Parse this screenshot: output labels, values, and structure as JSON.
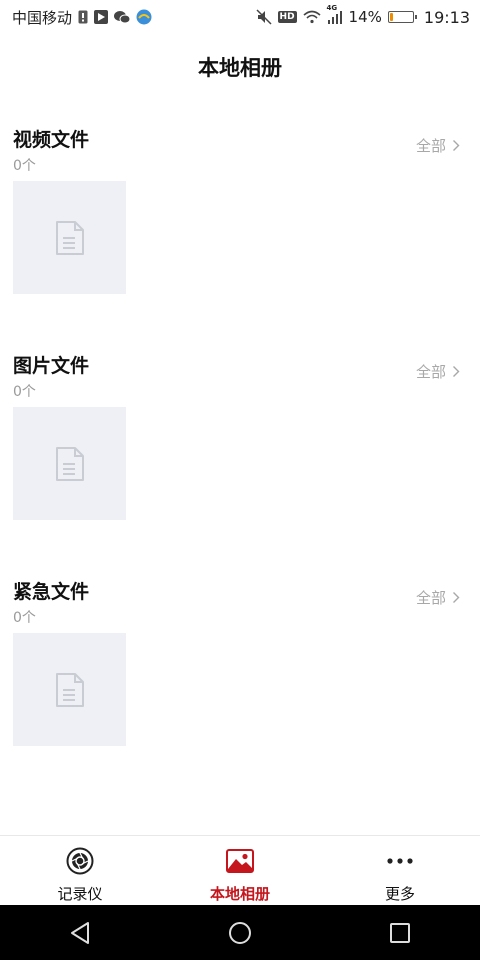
{
  "status_bar": {
    "carrier": "中国移动",
    "network_badge": "HD",
    "signal_type": "4G",
    "battery_percent": "14%",
    "battery_level": 0.14,
    "time": "19:13",
    "icons": [
      "sim-alert-icon",
      "play-store-icon",
      "wechat-icon",
      "app-icon",
      "mute-icon",
      "wifi-icon",
      "signal-icon",
      "battery-icon"
    ]
  },
  "header": {
    "title": "本地相册"
  },
  "sections": [
    {
      "title": "视频文件",
      "count": "0个",
      "all_label": "全部"
    },
    {
      "title": "图片文件",
      "count": "0个",
      "all_label": "全部"
    },
    {
      "title": "紧急文件",
      "count": "0个",
      "all_label": "全部"
    }
  ],
  "bottom_nav": {
    "items": [
      {
        "label": "记录仪",
        "icon": "camera-lens-icon",
        "active": false
      },
      {
        "label": "本地相册",
        "icon": "photo-album-icon",
        "active": true
      },
      {
        "label": "更多",
        "icon": "more-dots-icon",
        "active": false
      }
    ]
  },
  "colors": {
    "accent": "#c4161c",
    "placeholder_bg": "#eef0f5",
    "secondary_text": "#9a9a9a",
    "battery": "#f08c00"
  },
  "system_nav": {
    "buttons": [
      "back-icon",
      "home-icon",
      "recents-icon"
    ]
  }
}
